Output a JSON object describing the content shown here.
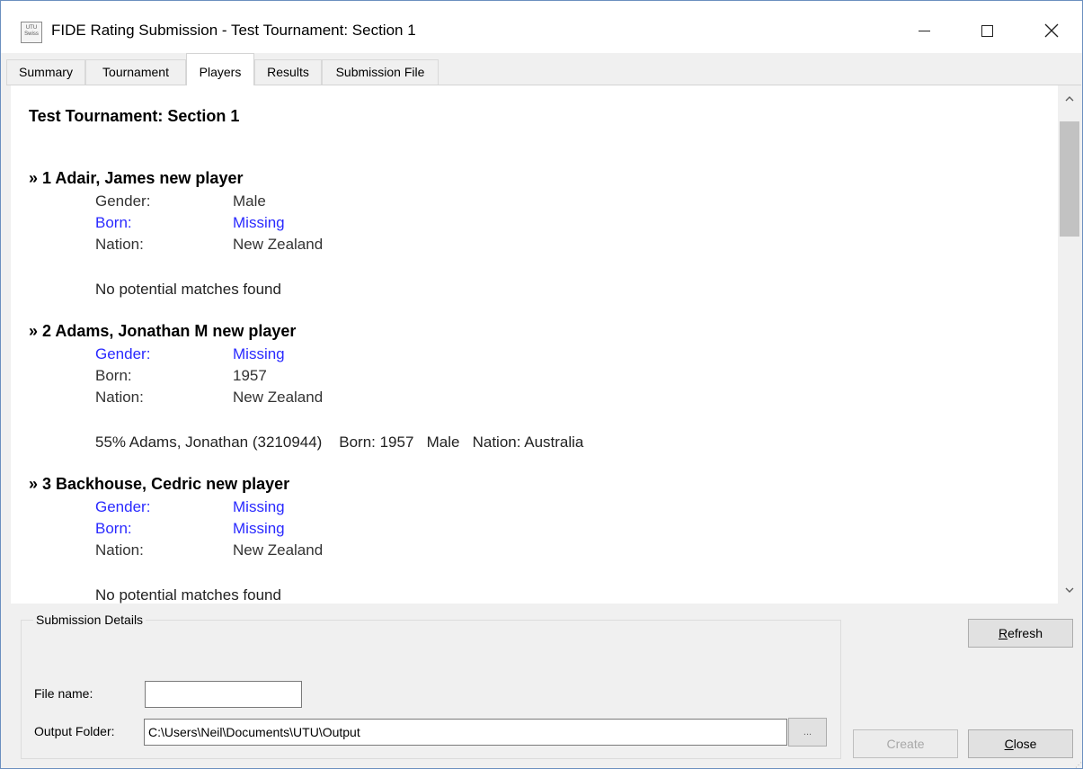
{
  "window": {
    "title": "FIDE Rating Submission - Test Tournament: Section 1",
    "icon_lines": [
      "UTU",
      "Swiss"
    ],
    "controls": [
      "minimize-icon",
      "maximize-icon",
      "close-icon"
    ]
  },
  "tabs": [
    {
      "label": "Summary",
      "active": false
    },
    {
      "label": "Tournament",
      "active": false
    },
    {
      "label": "Players",
      "active": true
    },
    {
      "label": "Results",
      "active": false
    },
    {
      "label": "Submission File",
      "active": false
    }
  ],
  "report": {
    "title": "Test Tournament: Section 1",
    "players": [
      {
        "heading": "» 1 Adair, James new player",
        "gender_label": "Gender:",
        "gender_value": "Male",
        "born_label": "Born:",
        "born_value": "Missing",
        "nation_label": "Nation:",
        "nation_value": "New Zealand",
        "matches": "No potential matches found"
      },
      {
        "heading": "» 2 Adams, Jonathan M new player",
        "gender_label": "Gender:",
        "gender_value": "Missing",
        "born_label": "Born:",
        "born_value": "1957",
        "nation_label": "Nation:",
        "nation_value": "New Zealand",
        "matches": "55% Adams, Jonathan (3210944)    Born: 1957   Male   Nation: Australia"
      },
      {
        "heading": "» 3 Backhouse, Cedric new player",
        "gender_label": "Gender:",
        "gender_value": "Missing",
        "born_label": "Born:",
        "born_value": "Missing",
        "nation_label": "Nation:",
        "nation_value": "New Zealand",
        "matches": "No potential matches found"
      }
    ]
  },
  "submission": {
    "group_title": "Submission Details",
    "file_name_label": "File name:",
    "file_name_value": "",
    "output_folder_label": "Output Folder:",
    "output_folder_value": "C:\\Users\\Neil\\Documents\\UTU\\Output",
    "browse_label": "...",
    "refresh_label": "Refresh",
    "refresh_rest": "efresh",
    "refresh_key": "R",
    "create_label": "Create",
    "close_key": "C",
    "close_rest": "lose"
  },
  "colors": {
    "missing": "#2a2aff",
    "window_border": "#6b8fbf"
  },
  "icons": {
    "scroll_up": "chevron-up-icon",
    "scroll_down": "chevron-down-icon"
  }
}
